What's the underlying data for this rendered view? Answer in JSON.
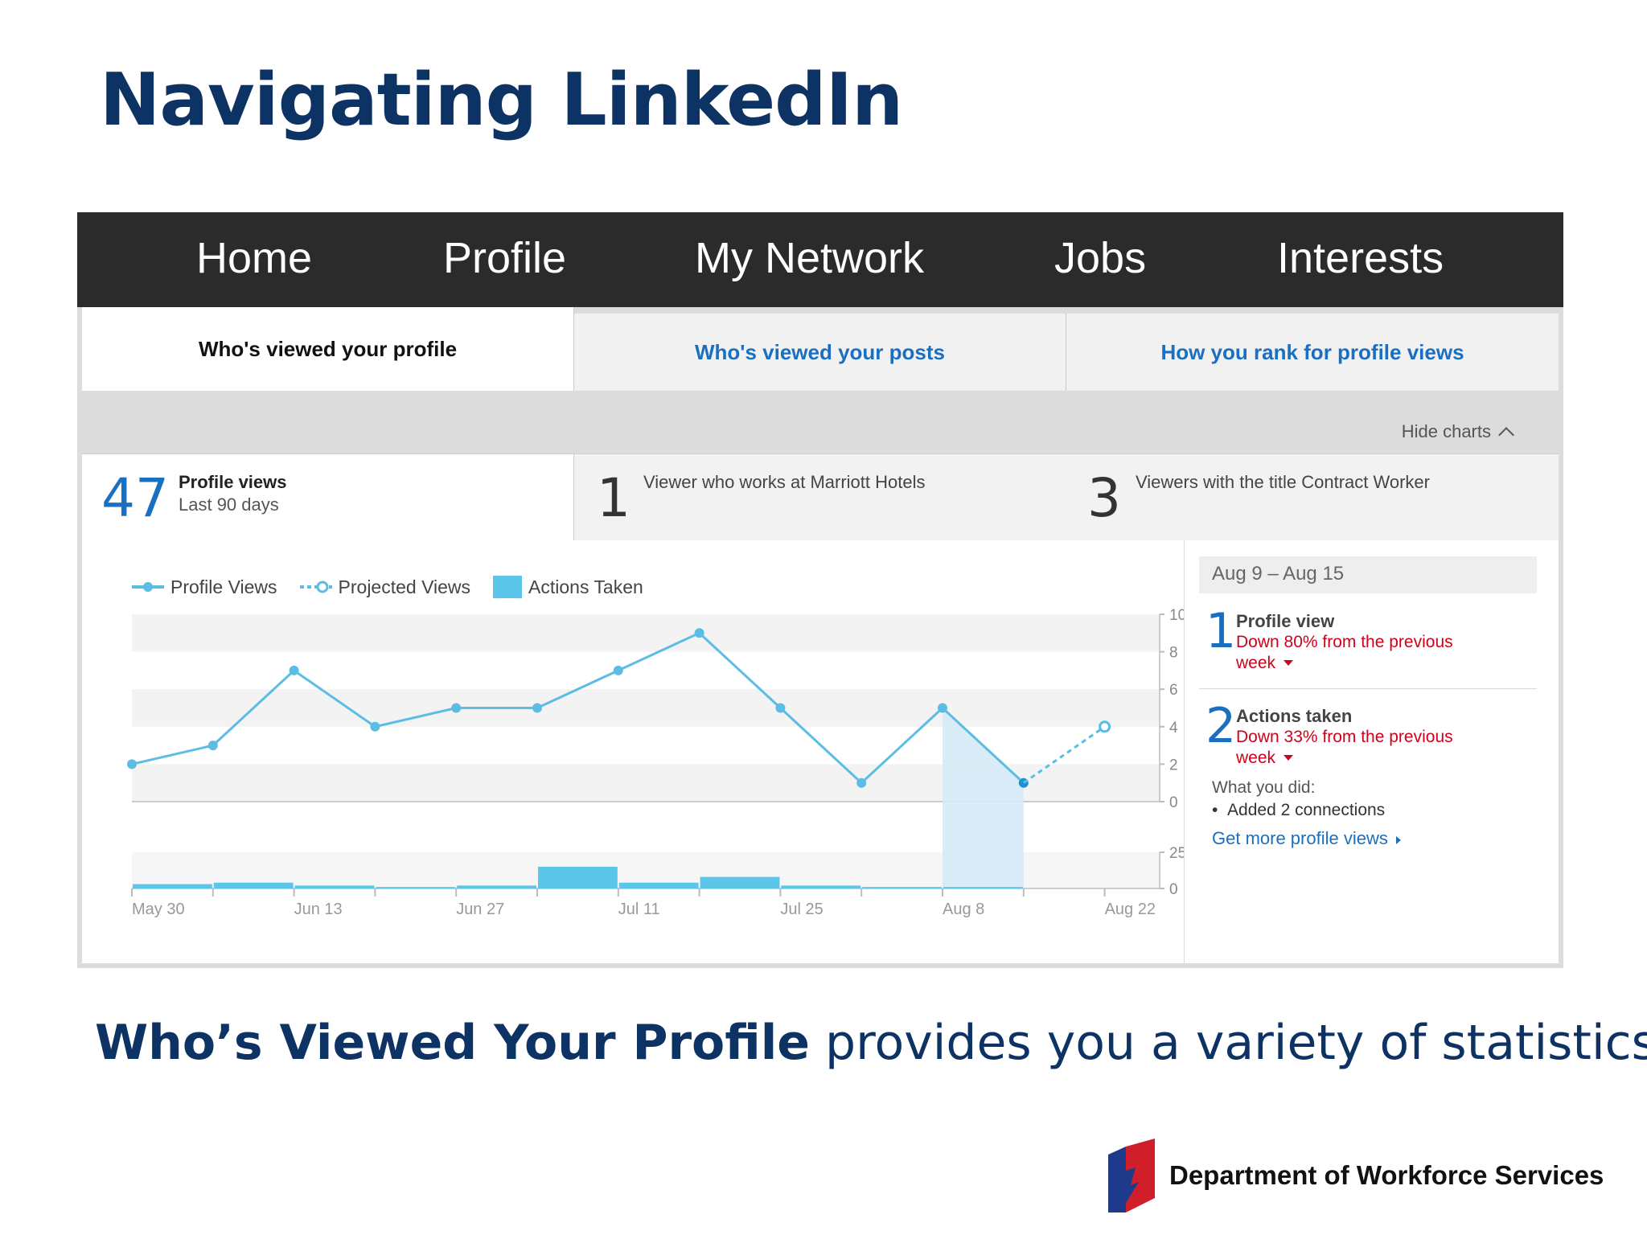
{
  "slide": {
    "title": "Navigating LinkedIn",
    "caption_bold": "Who’s Viewed Your Profile",
    "caption_rest": " provides you a variety of statistics.",
    "footer_org": "Department of Workforce Services"
  },
  "nav": {
    "items": [
      "Home",
      "Profile",
      "My Network",
      "Jobs",
      "Interests"
    ]
  },
  "tabs": [
    {
      "label": "Who's viewed your profile",
      "active": true
    },
    {
      "label": "Who's viewed your posts",
      "active": false
    },
    {
      "label": "How you rank for profile views",
      "active": false
    }
  ],
  "hide_charts": "Hide charts",
  "stats": {
    "views_count": "47",
    "views_label": "Profile views",
    "views_sub": "Last 90 days",
    "company_count": "1",
    "company_label": "Viewer who works at Marriott Hotels",
    "title_count": "3",
    "title_label": "Viewers with the title Contract Worker"
  },
  "legend": {
    "profile_views": "Profile Views",
    "projected_views": "Projected Views",
    "actions_taken": "Actions Taken"
  },
  "colors": {
    "line": "#5bbde4",
    "bar": "#5bc5ea",
    "nav_bg": "#2b2b2b",
    "link": "#1a6fc0",
    "down": "#d0021b",
    "title": "#0d3264"
  },
  "chart_data": {
    "type": "line",
    "x_tick_labels": [
      "May 30",
      "Jun 13",
      "Jun 27",
      "Jul 11",
      "Jul 25",
      "Aug 8",
      "Aug 22"
    ],
    "series": [
      {
        "name": "Profile Views",
        "values": [
          2,
          3,
          7,
          4,
          5,
          5,
          7,
          9,
          5,
          1,
          5,
          1
        ]
      },
      {
        "name": "Projected Views",
        "values": [
          1,
          4
        ]
      },
      {
        "name": "Actions Taken",
        "values": [
          3,
          4,
          2,
          1,
          2,
          15,
          4,
          8,
          2,
          1,
          1
        ]
      }
    ],
    "views_axis": {
      "ticks": [
        10,
        8,
        6,
        4,
        2,
        0
      ],
      "ylim": [
        0,
        10
      ]
    },
    "actions_axis": {
      "ticks": [
        25,
        0
      ],
      "ylim": [
        0,
        25
      ]
    },
    "highlight_week": "Aug 9 – Aug 15"
  },
  "side": {
    "week": "Aug 9 – Aug 15",
    "views_num": "1",
    "views_label": "Profile view",
    "views_change_1": "Down 80% from the previous",
    "views_change_2": "week",
    "actions_num": "2",
    "actions_label": "Actions taken",
    "actions_change_1": "Down 33% from the previous",
    "actions_change_2": "week",
    "did_label": "What you did:",
    "did_item": "Added 2 connections",
    "link": "Get more profile views"
  }
}
